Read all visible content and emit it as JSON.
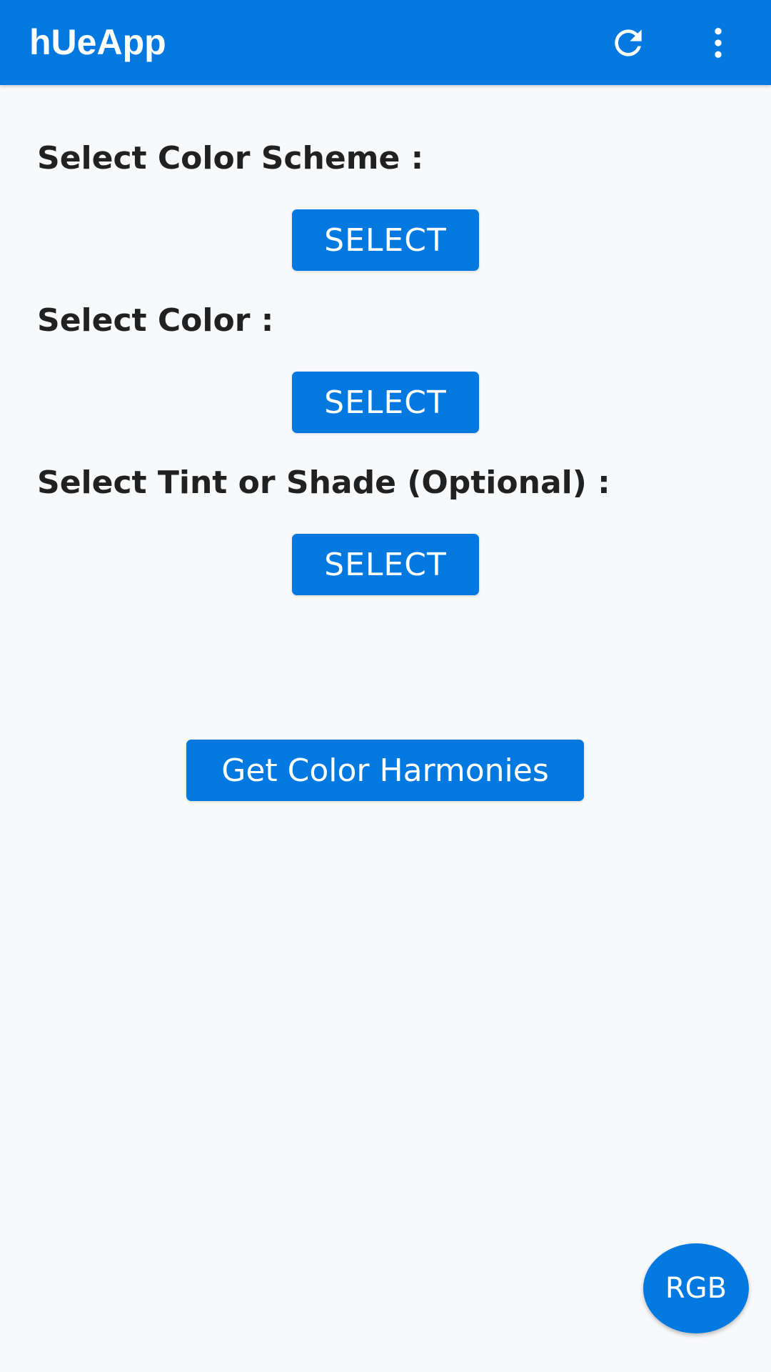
{
  "app_bar": {
    "title": "hUeApp",
    "actions": [
      {
        "icon": "refresh-icon"
      },
      {
        "icon": "more-vert-icon"
      }
    ],
    "background_color": "#0278e1"
  },
  "sections": [
    {
      "label": "Select Color Scheme :",
      "button_label": "SELECT"
    },
    {
      "label": "Select Color :",
      "button_label": "SELECT"
    },
    {
      "label": "Select Tint or Shade (Optional) :",
      "button_label": "SELECT"
    }
  ],
  "primary_action": {
    "label": "Get Color Harmonies"
  },
  "fab": {
    "label": "RGB"
  },
  "colors": {
    "accent": "#0278e1",
    "background": "#f8f9fa",
    "text": "#212121"
  }
}
